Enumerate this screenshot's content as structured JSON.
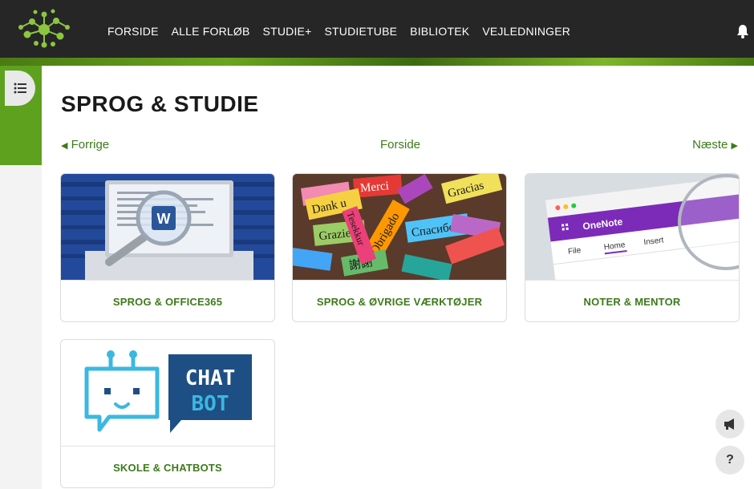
{
  "nav": {
    "items": [
      "FORSIDE",
      "ALLE FORLØB",
      "STUDIE+",
      "STUDIETUBE",
      "BIBLIOTEK",
      "VEJLEDNINGER"
    ]
  },
  "page": {
    "title": "SPROG & STUDIE",
    "prev_label": "Forrige",
    "home_label": "Forside",
    "next_label": "Næste"
  },
  "cards": [
    {
      "label": "SPROG & OFFICE365"
    },
    {
      "label": "SPROG & ØVRIGE VÆRKTØJER"
    },
    {
      "label": "NOTER & MENTOR"
    },
    {
      "label": "SKOLE & CHATBOTS"
    }
  ],
  "images": {
    "word_letter": "W",
    "words": [
      "Merci",
      "Dank u",
      "Gracias",
      "Grazie",
      "Obrigado",
      "Спасибо",
      "謝謝",
      "Tesekkur"
    ],
    "onenote": {
      "app": "OneNote",
      "tabs": [
        "File",
        "Home",
        "Insert"
      ]
    },
    "chatbot": {
      "line1": "CHAT",
      "line2": "BOT"
    }
  },
  "fabs": {
    "help": "?"
  },
  "colors": {
    "accent": "#3d7a1a",
    "brand_green": "#5da11f",
    "topbar": "#262626",
    "onenote_purple": "#7b2bb8",
    "chatbot_blue": "#1e4f84",
    "chatbot_cyan": "#3bb8e0"
  }
}
